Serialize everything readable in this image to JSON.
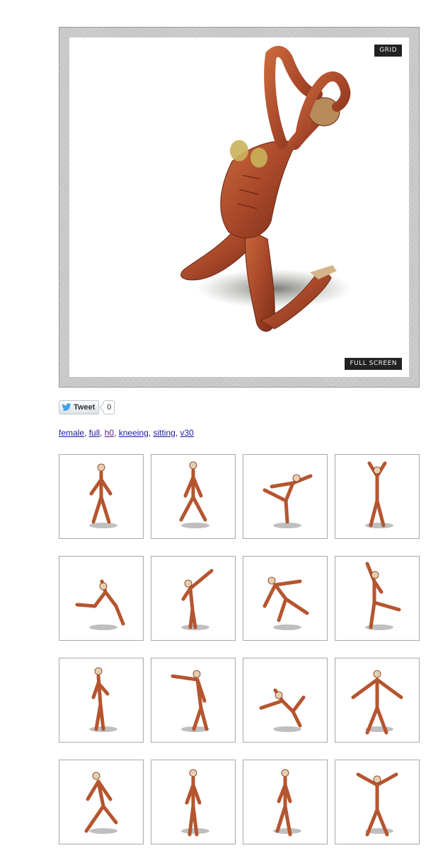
{
  "viewer": {
    "grid_label": "GRID",
    "fullscreen_label": "FULL SCREEN"
  },
  "social": {
    "tweet_label": "Tweet",
    "tweet_count": "0"
  },
  "tags": [
    {
      "label": "female",
      "visited": false
    },
    {
      "label": "full",
      "visited": false
    },
    {
      "label": "h0",
      "visited": true
    },
    {
      "label": "kneeing",
      "visited": false
    },
    {
      "label": "sitting",
      "visited": false
    },
    {
      "label": "v30",
      "visited": false
    }
  ],
  "tag_separator": ", ",
  "thumbnails": [
    {
      "pose": "standing-hands-on-hips",
      "icon": "female-figure-icon"
    },
    {
      "pose": "standing-legs-apart",
      "icon": "female-figure-icon"
    },
    {
      "pose": "ballet-arabesque",
      "icon": "female-figure-icon"
    },
    {
      "pose": "arms-overhead-standing",
      "icon": "female-figure-icon"
    },
    {
      "pose": "sitting-hugging-knees",
      "icon": "female-figure-icon"
    },
    {
      "pose": "reaching-up",
      "icon": "female-figure-icon"
    },
    {
      "pose": "crouching",
      "icon": "female-figure-icon"
    },
    {
      "pose": "dancing-kick",
      "icon": "female-figure-icon"
    },
    {
      "pose": "standing-side",
      "icon": "female-figure-icon"
    },
    {
      "pose": "pointing-arm",
      "icon": "female-figure-icon"
    },
    {
      "pose": "falling-back",
      "icon": "female-figure-icon"
    },
    {
      "pose": "arms-spread",
      "icon": "male-figure-icon"
    },
    {
      "pose": "fighting-stance",
      "icon": "male-figure-icon"
    },
    {
      "pose": "standing-relaxed",
      "icon": "female-figure-icon"
    },
    {
      "pose": "walking",
      "icon": "female-figure-icon"
    },
    {
      "pose": "flexing-muscles",
      "icon": "male-figure-icon"
    }
  ],
  "colors": {
    "muscle": "#b5552f",
    "muscle_dark": "#7a2e18",
    "tendon": "#e6cfae",
    "shadow": "#8a8a8a"
  }
}
